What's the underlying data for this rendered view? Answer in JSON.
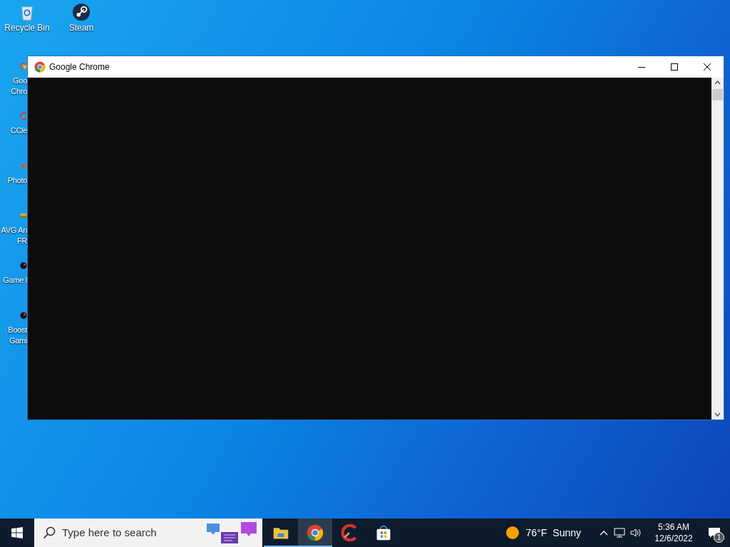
{
  "desktop_icons_top": [
    {
      "label": "Recycle Bin",
      "kind": "bin"
    },
    {
      "label": "Steam",
      "kind": "steam"
    }
  ],
  "desktop_icons_left": [
    {
      "lines": [
        "Goo",
        "Chro"
      ],
      "kind": "chrome"
    },
    {
      "lines": [
        "CCle"
      ],
      "kind": "ccleaner"
    },
    {
      "lines": [
        "Photo"
      ],
      "kind": "photo"
    },
    {
      "lines": [
        "AVG An",
        "FR"
      ],
      "kind": "avg"
    },
    {
      "lines": [
        "Game l"
      ],
      "kind": "game"
    },
    {
      "lines": [
        "Boost",
        "Gami"
      ],
      "kind": "game"
    }
  ],
  "window": {
    "title": "Google Chrome"
  },
  "taskbar": {
    "search": {
      "placeholder": "Type here to search"
    },
    "apps": [
      {
        "kind": "explorer",
        "running": true,
        "active": false
      },
      {
        "kind": "chrome",
        "running": true,
        "active": true
      },
      {
        "kind": "ccleaner",
        "running": false,
        "active": false
      },
      {
        "kind": "store",
        "running": false,
        "active": false
      }
    ],
    "weather": {
      "temp": "76°F",
      "condition": "Sunny"
    },
    "time": "5:36 AM",
    "date": "12/6/2022",
    "notifications": "1"
  }
}
